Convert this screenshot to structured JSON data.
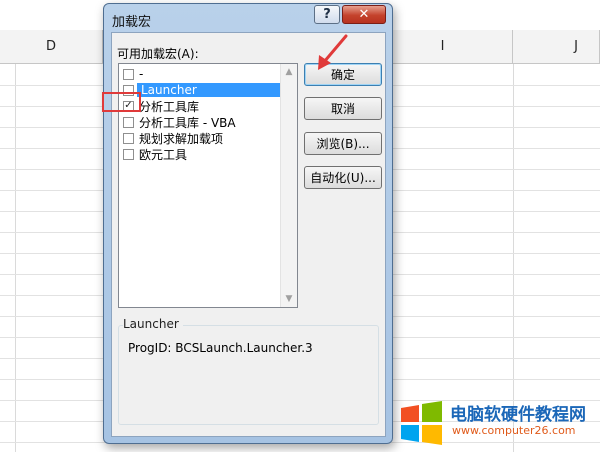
{
  "sheet": {
    "columns": [
      "D",
      "I",
      "J"
    ]
  },
  "dialog": {
    "title": "加载宏",
    "help_label": "?",
    "close_label": "✕",
    "list_label": "可用加载宏(A):",
    "items": [
      {
        "label": "-",
        "checked": false,
        "selected": false
      },
      {
        "label": "Launcher",
        "checked": false,
        "selected": true
      },
      {
        "label": "分析工具库",
        "checked": true,
        "selected": false
      },
      {
        "label": "分析工具库 - VBA",
        "checked": false,
        "selected": false
      },
      {
        "label": "规划求解加载项",
        "checked": false,
        "selected": false
      },
      {
        "label": "欧元工具",
        "checked": false,
        "selected": false
      }
    ],
    "buttons": {
      "ok": "确定",
      "cancel": "取消",
      "browse": "浏览(B)...",
      "automation": "自动化(U)..."
    },
    "description": {
      "name": "Launcher",
      "progid": "ProgID: BCSLaunch.Launcher.3"
    }
  },
  "watermark": {
    "title": "电脑软硬件教程网",
    "url": "www.computer26.com"
  },
  "colors": {
    "selection": "#3399ff",
    "annotation": "#e03a3a",
    "close_button": "#c4422c"
  }
}
